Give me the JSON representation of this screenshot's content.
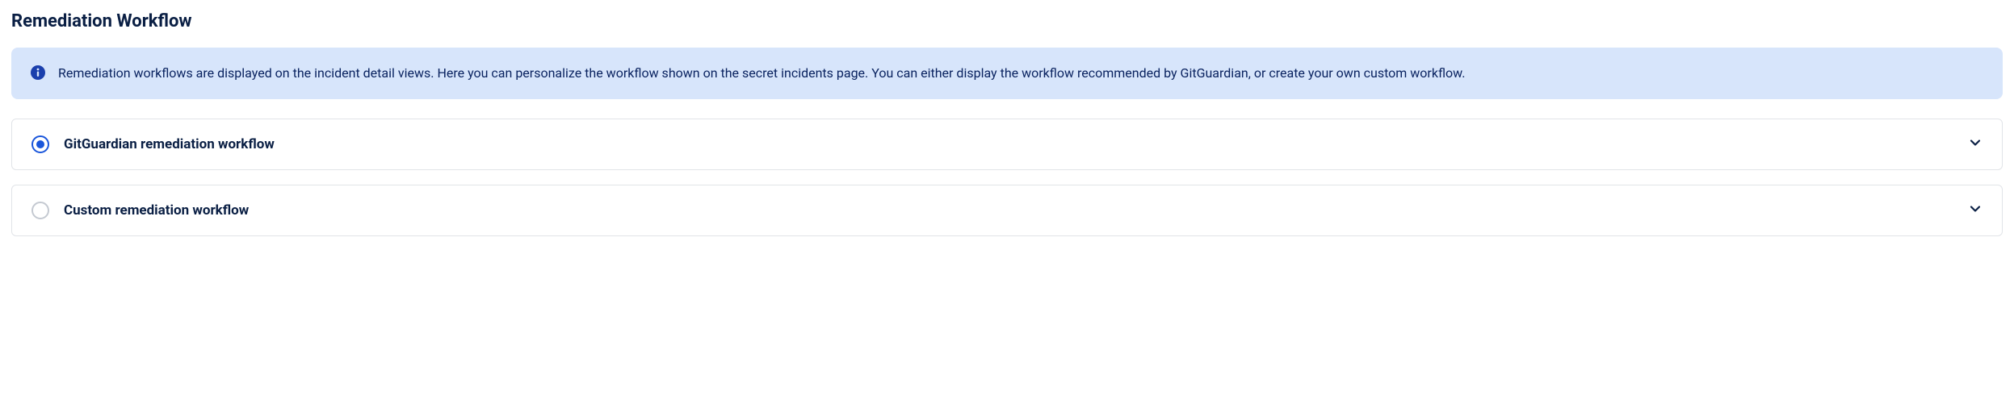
{
  "section": {
    "title": "Remediation Workflow"
  },
  "banner": {
    "text": "Remediation workflows are displayed on the incident detail views. Here you can personalize the workflow shown on the secret incidents page. You can either display the workflow recommended by GitGuardian, or create your own custom workflow."
  },
  "options": [
    {
      "label": "GitGuardian remediation workflow",
      "selected": true
    },
    {
      "label": "Custom remediation workflow",
      "selected": false
    }
  ],
  "colors": {
    "accent": "#1a56db",
    "text_dark": "#0a1f44",
    "banner_bg": "#d7e5fb",
    "banner_text": "#0a2360"
  }
}
